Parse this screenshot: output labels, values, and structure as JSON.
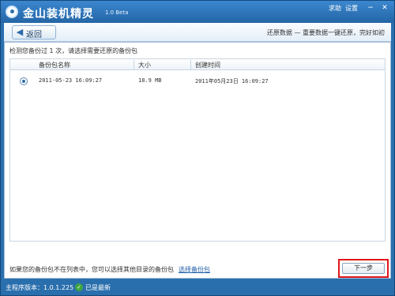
{
  "app": {
    "title": "金山装机精灵",
    "version": "1.0 Beta",
    "links": {
      "help": "求助",
      "settings": "设置"
    },
    "window_controls": {
      "minimize": "−",
      "close": "✕"
    }
  },
  "nav": {
    "back_label": "返回",
    "breadcrumb": "还原数据 — 重要数据一键还原，完好如初"
  },
  "content": {
    "info_text": "检测您备份过 1 次，请选择需要还原的备份包",
    "table": {
      "columns": [
        "备份包名称",
        "大小",
        "创建时间"
      ],
      "rows": [
        {
          "name": "2011-05-23 16:09:27",
          "size": "18.9 MB",
          "created": "2011年05月23日 16:09:27",
          "selected": true
        }
      ]
    },
    "bottom_text": "如果您的备份包不在列表中，您可以选择其他目录的备份包",
    "choose_link": "选择备份包",
    "next_button": "下一步"
  },
  "status": {
    "version_text": "主程序版本：1.0.1.225",
    "latest_text": "已是最新"
  },
  "colors": {
    "accent": "#2a6fad",
    "highlight": "#e0151b",
    "link": "#1f5fa8",
    "ok": "#3fa63f"
  }
}
